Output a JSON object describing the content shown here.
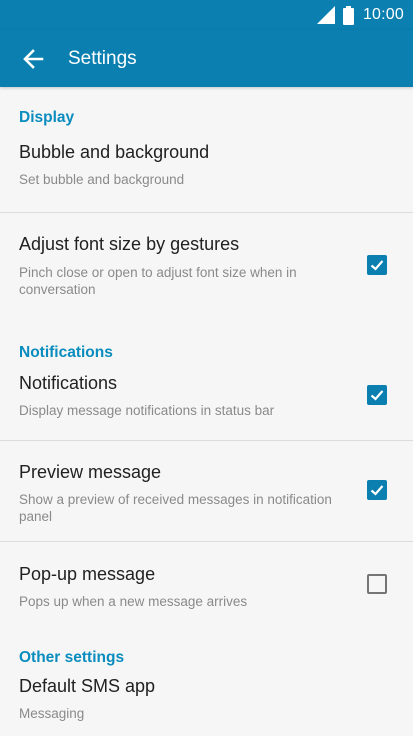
{
  "status_bar": {
    "time": "10:00",
    "signal_icon": "signal-icon",
    "battery_icon": "battery-icon"
  },
  "app_bar": {
    "title": "Settings",
    "back_icon": "arrow-back-icon"
  },
  "colors": {
    "primary": "#0a7fb0",
    "accent_text": "#0a8cbe",
    "background": "#f6f6f6"
  },
  "sections": {
    "display": {
      "header": "Display",
      "bubble": {
        "title": "Bubble and background",
        "subtitle": "Set bubble and background"
      },
      "font_size": {
        "title": "Adjust font size by gestures",
        "subtitle": "Pinch close or open to adjust font size when in conversation",
        "checked": true
      }
    },
    "notifications": {
      "header": "Notifications",
      "notifications": {
        "title": "Notifications",
        "subtitle": "Display message notifications in status bar",
        "checked": true
      },
      "preview": {
        "title": "Preview message",
        "subtitle": "Show a preview of received messages in notification panel",
        "checked": true
      },
      "popup": {
        "title": "Pop-up message",
        "subtitle": "Pops up when a new message arrives",
        "checked": false
      }
    },
    "other": {
      "header": "Other settings",
      "default_sms": {
        "title": "Default SMS app",
        "subtitle": "Messaging"
      }
    }
  }
}
